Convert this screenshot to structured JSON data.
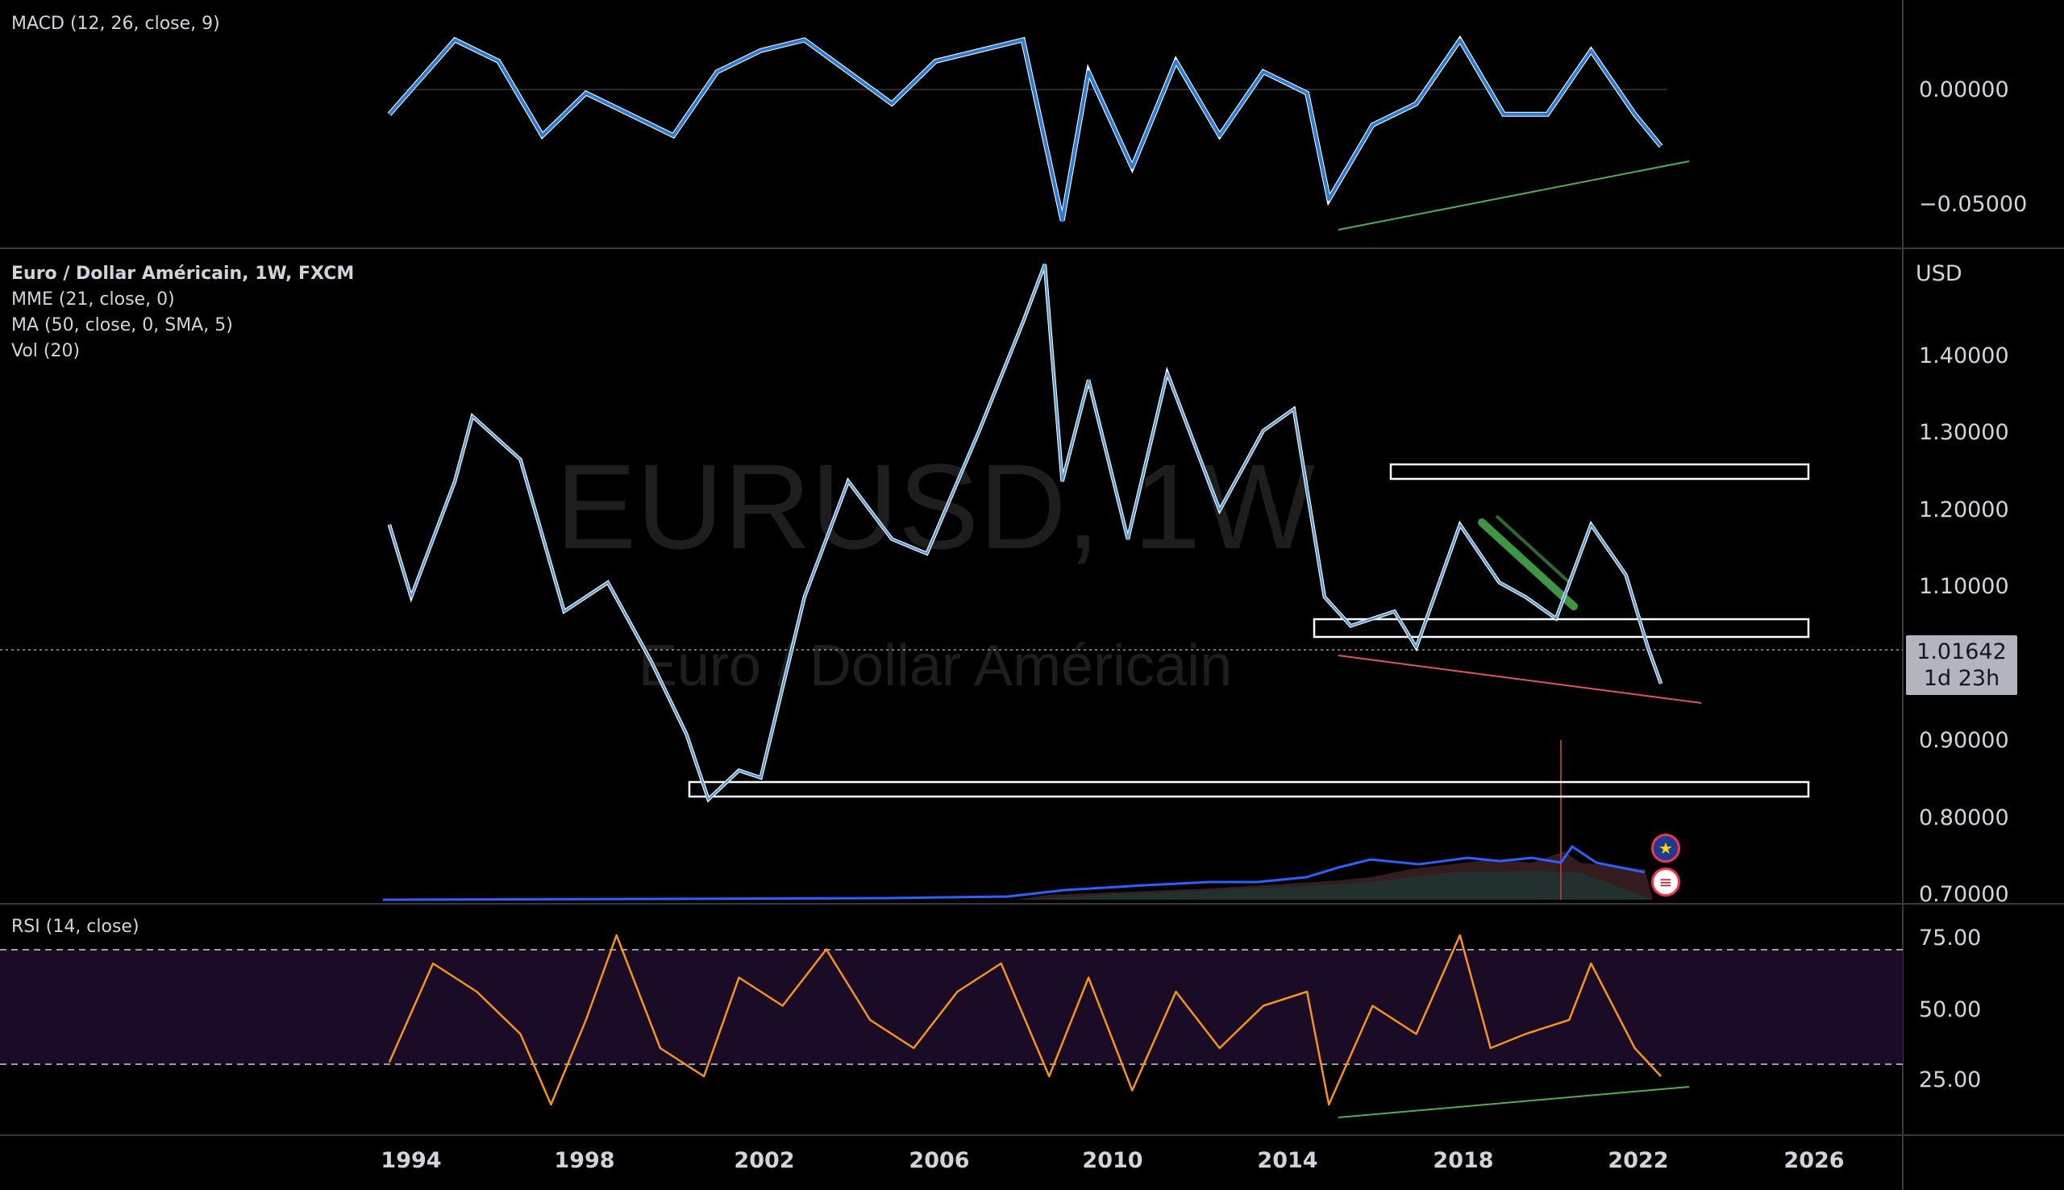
{
  "colors": {
    "background": "#000000",
    "separator": "#3a3a3a",
    "macd_line": "#2e7bd6",
    "signal_line": "#ffffff",
    "price_line": "#5b9bd5",
    "ema_line": "#ffffff",
    "rsi_line": "#f7931a",
    "rsi_band": "#1a0b26",
    "support_zone": "#ffffff",
    "channel": "#4caf50",
    "divergence_up": "#4caf50",
    "divergence_down": "#e05555",
    "volume_ma": "#2962ff",
    "text": "#d1d4dc"
  },
  "watermark": {
    "symbol": "EURUSD, 1W",
    "description": "Euro / Dollar Américain"
  },
  "macd_pane": {
    "legend": "MACD (12, 26, close, 9)",
    "axis_labels": [
      "0.00000",
      "−0.05000"
    ]
  },
  "price_pane": {
    "legend_title": "Euro / Dollar Américain, 1W, FXCM",
    "legend_lines": [
      "MME (21, close, 0)",
      "MA (50, close, 0, SMA, 5)",
      "Vol (20)"
    ],
    "currency": "USD",
    "axis_labels": [
      "1.40000",
      "1.30000",
      "1.20000",
      "1.10000",
      "0.90000",
      "0.80000",
      "0.70000"
    ],
    "last_price": "1.01642",
    "countdown": "1d 23h"
  },
  "events": {
    "eu_icon": "eu-flag-icon",
    "us_icon": "us-flag-icon"
  },
  "rsi_pane": {
    "legend": "RSI (14, close)",
    "axis_labels": [
      "75.00",
      "50.00",
      "25.00"
    ]
  },
  "time_axis": {
    "labels": [
      "1994",
      "1998",
      "2002",
      "2006",
      "2010",
      "2014",
      "2018",
      "2022",
      "2026"
    ]
  },
  "chart_data": [
    {
      "type": "line",
      "title": "MACD (12, 26, close, 9)",
      "x": [
        1993.5,
        1995.0,
        1996.0,
        1997.0,
        1998.0,
        1999.0,
        2000.0,
        2001.0,
        2002.0,
        2003.0,
        2004.0,
        2005.0,
        2006.0,
        2007.0,
        2008.0,
        2008.9,
        2009.5,
        2010.5,
        2011.5,
        2012.5,
        2013.5,
        2014.5,
        2015.0,
        2016.0,
        2017.0,
        2018.0,
        2019.0,
        2020.0,
        2021.0,
        2022.0,
        2022.6
      ],
      "series": [
        {
          "values": [
            -0.01,
            0.025,
            0.015,
            -0.02,
            0.0,
            -0.01,
            -0.02,
            0.01,
            0.02,
            0.025,
            0.01,
            -0.005,
            0.015,
            0.02,
            0.025,
            -0.06,
            0.01,
            -0.035,
            0.015,
            -0.02,
            0.01,
            0.0,
            -0.05,
            -0.015,
            -0.005,
            0.025,
            -0.01,
            -0.01,
            0.02,
            -0.01,
            -0.025
          ]
        }
      ],
      "ylim": [
        -0.07,
        0.04
      ]
    },
    {
      "type": "line",
      "title": "Euro / Dollar Américain, 1W, FXCM",
      "x": [
        1993.5,
        1994.0,
        1995.0,
        1995.4,
        1996.5,
        1997.5,
        1998.5,
        1999.5,
        2000.3,
        2000.8,
        2001.5,
        2002.0,
        2003.0,
        2004.0,
        2005.0,
        2005.8,
        2007.0,
        2008.0,
        2008.5,
        2008.9,
        2009.5,
        2010.4,
        2011.3,
        2012.5,
        2013.5,
        2014.2,
        2014.9,
        2015.5,
        2016.5,
        2017.0,
        2018.0,
        2018.9,
        2019.5,
        2020.2,
        2021.0,
        2021.8,
        2022.3,
        2022.6
      ],
      "series": [
        {
          "name": "EURUSD",
          "values": [
            1.22,
            1.12,
            1.28,
            1.37,
            1.31,
            1.1,
            1.14,
            1.03,
            0.93,
            0.84,
            0.88,
            0.87,
            1.12,
            1.28,
            1.2,
            1.18,
            1.35,
            1.5,
            1.58,
            1.28,
            1.42,
            1.2,
            1.43,
            1.24,
            1.35,
            1.38,
            1.12,
            1.08,
            1.1,
            1.05,
            1.22,
            1.14,
            1.12,
            1.09,
            1.22,
            1.15,
            1.05,
            1.0
          ]
        }
      ],
      "ylim": [
        0.7,
        1.6
      ]
    },
    {
      "type": "line",
      "title": "RSI (14, close)",
      "x": [
        1993.5,
        1994.5,
        1995.5,
        1996.5,
        1997.2,
        1998.0,
        1998.7,
        1999.7,
        2000.7,
        2001.5,
        2002.5,
        2003.5,
        2004.5,
        2005.5,
        2006.5,
        2007.5,
        2008.6,
        2009.5,
        2010.5,
        2011.5,
        2012.5,
        2013.5,
        2014.5,
        2015.0,
        2016.0,
        2017.0,
        2018.0,
        2018.7,
        2019.5,
        2020.5,
        2021.0,
        2022.0,
        2022.6
      ],
      "series": [
        {
          "values": [
            35,
            70,
            60,
            45,
            20,
            50,
            80,
            40,
            30,
            65,
            55,
            75,
            50,
            40,
            60,
            70,
            30,
            65,
            25,
            60,
            40,
            55,
            60,
            20,
            55,
            45,
            80,
            40,
            45,
            50,
            70,
            40,
            30
          ]
        }
      ],
      "ylim": [
        10,
        90
      ]
    }
  ]
}
